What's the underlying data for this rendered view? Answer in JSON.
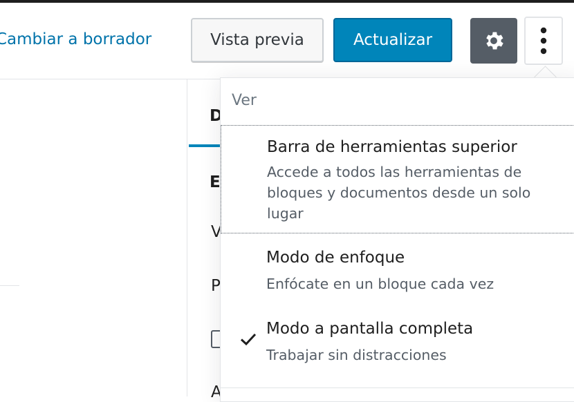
{
  "header": {
    "switch_to_draft": "Cambiar a borrador",
    "preview": "Vista previa",
    "update": "Actualizar",
    "settings_icon": "gear-icon",
    "more_icon": "more-vertical-icon"
  },
  "sidebar": {
    "tab_fragment": "D",
    "heading_fragment": "E",
    "row_fragments": [
      "V",
      "P",
      "A"
    ]
  },
  "menu": {
    "group_label": "Ver",
    "items": [
      {
        "label": "Barra de herramientas superior",
        "description": "Accede a todos las herramientas de bloques y documentos desde un solo lugar",
        "checked": false
      },
      {
        "label": "Modo de enfoque",
        "description": "Enfócate en un bloque cada vez",
        "checked": false
      },
      {
        "label": "Modo a pantalla completa",
        "description": "Trabajar sin distracciones",
        "checked": true
      }
    ]
  },
  "colors": {
    "accent": "#0085ba",
    "link": "#0073aa",
    "settings_bg": "#555d66",
    "muted_text": "#555d66"
  }
}
